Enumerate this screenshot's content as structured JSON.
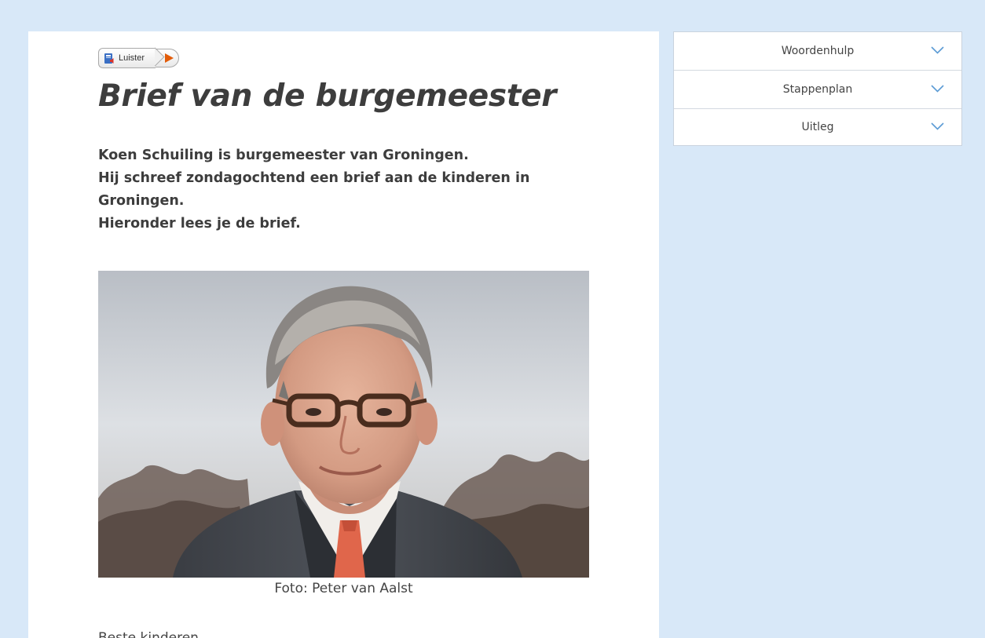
{
  "article": {
    "listen_label": "Luister",
    "title": "Brief van de burgemeester",
    "intro_lines": [
      "Koen Schuiling is burgemeester van Groningen.",
      "Hij schreef zondagochtend een brief aan de kinderen in Groningen.",
      "Hieronder lees je de brief."
    ],
    "photo_caption": "Foto: Peter van Aalst",
    "salutation": "Beste kinderen,"
  },
  "sidebar": {
    "items": [
      {
        "label": "Woordenhulp",
        "icon": "chevron-down-icon"
      },
      {
        "label": "Stappenplan",
        "icon": "chevron-down-icon"
      },
      {
        "label": "Uitleg",
        "icon": "chevron-down-icon"
      }
    ]
  },
  "colors": {
    "background": "#d8e8f8",
    "chevron": "#5b9bd5",
    "play": "#e25c0a",
    "text": "#3d3d3d"
  }
}
